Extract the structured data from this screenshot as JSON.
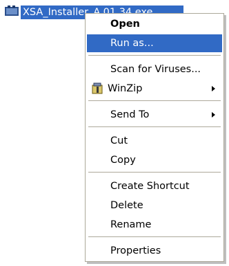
{
  "file": {
    "name": "XSA_Installer_A.01.34.exe"
  },
  "context_menu": {
    "open": "Open",
    "run_as": "Run as...",
    "scan": "Scan for Viruses...",
    "winzip": "WinZip",
    "send_to": "Send To",
    "cut": "Cut",
    "copy": "Copy",
    "create_shortcut": "Create Shortcut",
    "delete": "Delete",
    "rename": "Rename",
    "properties": "Properties",
    "highlighted_item": "run_as",
    "highlight_color": "#316ac5"
  }
}
